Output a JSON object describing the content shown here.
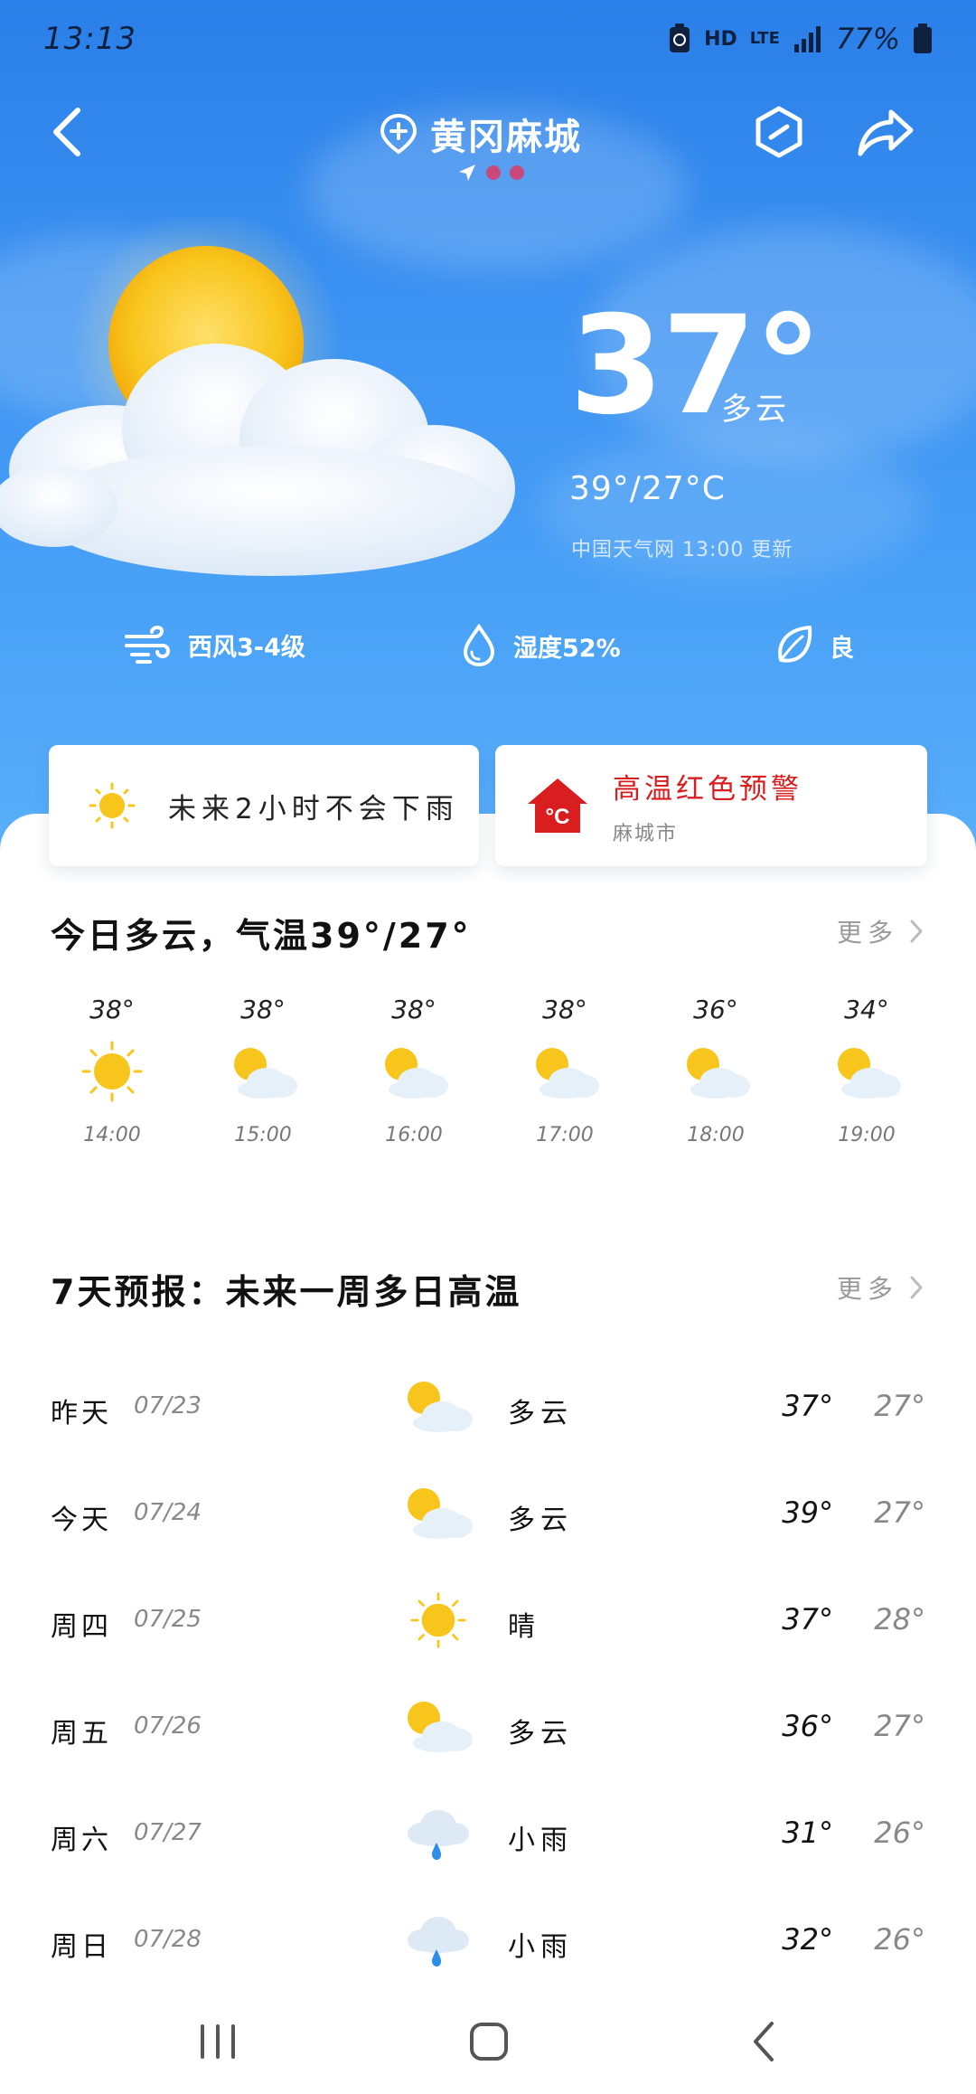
{
  "status_bar": {
    "time": "13:13",
    "hd": "HD",
    "lte": "LTE",
    "battery": "77%"
  },
  "header": {
    "city": "黄冈麻城",
    "back_icon": "back-arrow-icon",
    "add_icon": "add-location-icon",
    "settings_icon": "hexagon-minus-icon",
    "share_icon": "share-icon"
  },
  "current": {
    "temperature": "37°",
    "condition": "多云",
    "range": "39°/27°C",
    "source": "中国天气网 13:00 更新",
    "icon": "sun-behind-cloud-icon"
  },
  "metrics": [
    {
      "icon": "wind-icon",
      "label": "西风3-4级"
    },
    {
      "icon": "humidity-drop-icon",
      "label": "湿度52%"
    },
    {
      "icon": "leaf-icon",
      "label": "良"
    }
  ],
  "cards": {
    "rain": {
      "icon": "sun-icon",
      "text": "未来2小时不会下雨"
    },
    "alert": {
      "icon": "heat-alert-house-icon",
      "icon_text": "°C",
      "title": "高温红色预警",
      "subtitle": "麻城市",
      "color": "#d81e1e"
    }
  },
  "today": {
    "title": "今日多云，气温39°/27°",
    "more": "更多",
    "hours": [
      {
        "temp": "38°",
        "icon": "sun",
        "time": "14:00"
      },
      {
        "temp": "38°",
        "icon": "partly-cloudy",
        "time": "15:00"
      },
      {
        "temp": "38°",
        "icon": "partly-cloudy",
        "time": "16:00"
      },
      {
        "temp": "38°",
        "icon": "partly-cloudy",
        "time": "17:00"
      },
      {
        "temp": "36°",
        "icon": "partly-cloudy",
        "time": "18:00"
      },
      {
        "temp": "34°",
        "icon": "partly-cloudy",
        "time": "19:00"
      }
    ]
  },
  "forecast": {
    "title": "7天预报：未来一周多日高温",
    "more": "更多",
    "days": [
      {
        "day": "昨天",
        "date": "07/23",
        "icon": "partly-cloudy",
        "condition": "多云",
        "high": "37°",
        "low": "27°"
      },
      {
        "day": "今天",
        "date": "07/24",
        "icon": "partly-cloudy",
        "condition": "多云",
        "high": "39°",
        "low": "27°"
      },
      {
        "day": "周四",
        "date": "07/25",
        "icon": "sun",
        "condition": "晴",
        "high": "37°",
        "low": "28°"
      },
      {
        "day": "周五",
        "date": "07/26",
        "icon": "partly-cloudy",
        "condition": "多云",
        "high": "36°",
        "low": "27°"
      },
      {
        "day": "周六",
        "date": "07/27",
        "icon": "light-rain",
        "condition": "小雨",
        "high": "31°",
        "low": "26°"
      },
      {
        "day": "周日",
        "date": "07/28",
        "icon": "light-rain",
        "condition": "小雨",
        "high": "32°",
        "low": "26°"
      }
    ]
  },
  "colors": {
    "sky_top": "#2a7fe8",
    "sky_bottom": "#5db1fa",
    "sun": "#f8c51c",
    "alert_red": "#d81e1e"
  },
  "nav": {
    "recents_icon": "recents-icon",
    "home_icon": "home-icon",
    "back_icon": "nav-back-icon"
  }
}
